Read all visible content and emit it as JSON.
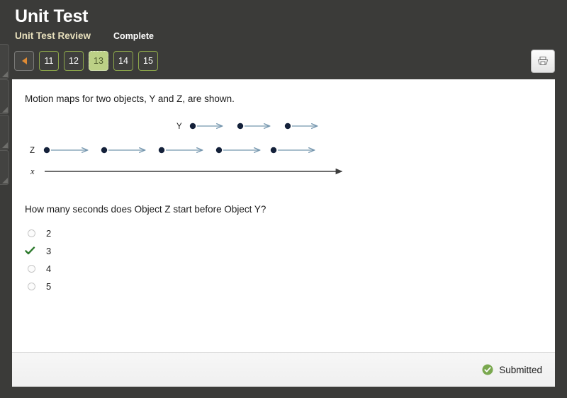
{
  "header": {
    "title": "Unit Test",
    "subtitle": "Unit Test Review",
    "status": "Complete",
    "subtitle_color": "#e8e0bd",
    "print_icon": "printer-icon"
  },
  "pager": {
    "prev_icon": "caret-left-icon",
    "pages": [
      {
        "label": "11",
        "active": false
      },
      {
        "label": "12",
        "active": false
      },
      {
        "label": "13",
        "active": true
      },
      {
        "label": "14",
        "active": false
      },
      {
        "label": "15",
        "active": false
      }
    ],
    "active_bg": "#bcd186",
    "border_color": "#8ca64a"
  },
  "question": {
    "prompt": "Motion maps for two objects, Y and Z, are shown.",
    "text": "How many seconds does Object Z start before Object Y?",
    "options": [
      {
        "label": "2",
        "selected": false
      },
      {
        "label": "3",
        "selected": true
      },
      {
        "label": "4",
        "selected": false
      },
      {
        "label": "5",
        "selected": false
      }
    ],
    "check_color": "#2d7a2d"
  },
  "motion_map": {
    "series": [
      {
        "name": "Y",
        "label": "Y",
        "row_y": 14,
        "label_x": 214,
        "dots_x": [
          233,
          300,
          367
        ],
        "arrow_length": 41
      },
      {
        "name": "Z",
        "label": "Z",
        "row_y": 48,
        "label_x": 8,
        "dots_x": [
          28,
          109,
          190,
          271,
          348
        ],
        "arrow_length": 55
      }
    ],
    "axis": {
      "label": "x",
      "label_x": 10,
      "y": 78,
      "start_x": 27,
      "end_x": 445,
      "color": "#3d3d3d"
    },
    "dot_color": "#14213a",
    "arrow_color": "#7596ae"
  },
  "footer": {
    "status_label": "Submitted",
    "status_icon": "check-circle-icon",
    "status_color": "#7aa84f"
  }
}
